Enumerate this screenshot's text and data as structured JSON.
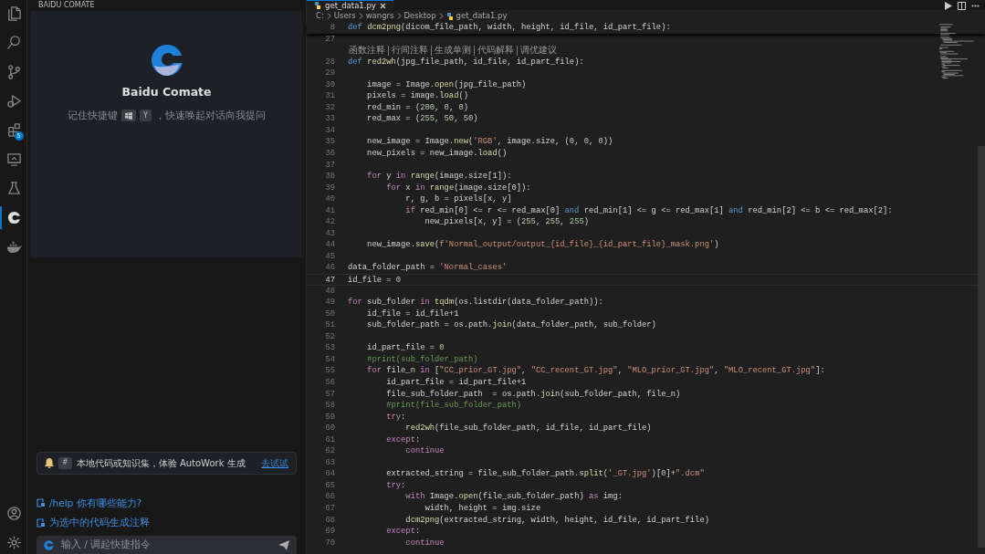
{
  "activity_bar": {
    "items": [
      {
        "kind": "files",
        "selected": false
      },
      {
        "kind": "search",
        "selected": false
      },
      {
        "kind": "source-control",
        "selected": false
      },
      {
        "kind": "run",
        "selected": false
      },
      {
        "kind": "extensions",
        "selected": false,
        "badge": "5"
      },
      {
        "kind": "remote",
        "selected": false
      },
      {
        "kind": "flask",
        "selected": false
      },
      {
        "kind": "comate",
        "selected": true
      },
      {
        "kind": "docker",
        "selected": false
      }
    ],
    "bottom": [
      {
        "kind": "account"
      },
      {
        "kind": "settings"
      }
    ]
  },
  "sidebar": {
    "title": "BAIDU COMATE",
    "welcome": {
      "title": "Baidu Comate",
      "hint_before": "记住快捷键",
      "key": "Y",
      "hint_after": "，快速唤起对话向我提问"
    },
    "notice": {
      "key": "#",
      "text": "本地代码或知识集，体验 AutoWork 生成",
      "link": "去试试"
    },
    "suggestions": [
      "/help 你有哪些能力?",
      "为选中的代码生成注释"
    ],
    "input": {
      "placeholder": "输入 / 调起快捷指令"
    }
  },
  "editor": {
    "tab": {
      "label": "get_data1.py"
    },
    "breadcrumbs": [
      "C:",
      "Users",
      "wangrs",
      "Desktop",
      "get_data1.py"
    ],
    "sticky": {
      "n": "8",
      "s": [
        {
          "kind": "kw",
          "t": "def "
        },
        {
          "kind": "fn",
          "t": "dcm2png"
        },
        {
          "kind": "p",
          "t": "(dicom_file_path, width, height, id_file, id_part_file):"
        }
      ]
    },
    "codelens": [
      "函数注释",
      "行间注释",
      "生成单测",
      "代码解释",
      "调优建议"
    ],
    "lines": [
      {
        "n": "27",
        "current": false
      },
      {
        "n": "28",
        "current": false,
        "lens": true,
        "s": [
          {
            "kind": "kw",
            "t": "def "
          },
          {
            "kind": "fn",
            "t": "red2wh"
          },
          {
            "kind": "p",
            "t": "(jpg_file_path, id_file, id_part_file):"
          }
        ]
      },
      {
        "n": "29",
        "current": false
      },
      {
        "n": "30",
        "current": false,
        "s": [
          {
            "kind": "p",
            "t": "    image = Image."
          },
          {
            "kind": "fn",
            "t": "open"
          },
          {
            "kind": "p",
            "t": "(jpg_file_path)"
          }
        ]
      },
      {
        "n": "31",
        "current": false,
        "s": [
          {
            "kind": "p",
            "t": "    pixels = image."
          },
          {
            "kind": "fn",
            "t": "load"
          },
          {
            "kind": "p",
            "t": "()"
          }
        ]
      },
      {
        "n": "32",
        "current": false,
        "s": [
          {
            "kind": "p",
            "t": "    red_min = ("
          },
          {
            "kind": "num",
            "t": "200"
          },
          {
            "kind": "p",
            "t": ", "
          },
          {
            "kind": "num",
            "t": "0"
          },
          {
            "kind": "p",
            "t": ", "
          },
          {
            "kind": "num",
            "t": "0"
          },
          {
            "kind": "p",
            "t": ")"
          }
        ]
      },
      {
        "n": "33",
        "current": false,
        "s": [
          {
            "kind": "p",
            "t": "    red_max = ("
          },
          {
            "kind": "num",
            "t": "255"
          },
          {
            "kind": "p",
            "t": ", "
          },
          {
            "kind": "num",
            "t": "50"
          },
          {
            "kind": "p",
            "t": ", "
          },
          {
            "kind": "num",
            "t": "50"
          },
          {
            "kind": "p",
            "t": ")"
          }
        ]
      },
      {
        "n": "34",
        "current": false
      },
      {
        "n": "35",
        "current": false,
        "s": [
          {
            "kind": "p",
            "t": "    new_image = Image."
          },
          {
            "kind": "fn",
            "t": "new"
          },
          {
            "kind": "p",
            "t": "("
          },
          {
            "kind": "str",
            "t": "'RGB'"
          },
          {
            "kind": "p",
            "t": ", image.size, ("
          },
          {
            "kind": "num",
            "t": "0"
          },
          {
            "kind": "p",
            "t": ", "
          },
          {
            "kind": "num",
            "t": "0"
          },
          {
            "kind": "p",
            "t": ", "
          },
          {
            "kind": "num",
            "t": "0"
          },
          {
            "kind": "p",
            "t": "))"
          }
        ]
      },
      {
        "n": "36",
        "current": false,
        "s": [
          {
            "kind": "p",
            "t": "    new_pixels = new_image."
          },
          {
            "kind": "fn",
            "t": "load"
          },
          {
            "kind": "p",
            "t": "()"
          }
        ]
      },
      {
        "n": "37",
        "current": false
      },
      {
        "n": "38",
        "current": false,
        "s": [
          {
            "kind": "ctl",
            "t": "    for"
          },
          {
            "kind": "p",
            "t": " y "
          },
          {
            "kind": "ctl",
            "t": "in "
          },
          {
            "kind": "fn",
            "t": "range"
          },
          {
            "kind": "p",
            "t": "(image.size[1]):"
          }
        ]
      },
      {
        "n": "39",
        "current": false,
        "s": [
          {
            "kind": "ctl",
            "t": "        for"
          },
          {
            "kind": "p",
            "t": " x "
          },
          {
            "kind": "ctl",
            "t": "in "
          },
          {
            "kind": "fn",
            "t": "range"
          },
          {
            "kind": "p",
            "t": "(image.size[0]):"
          }
        ]
      },
      {
        "n": "40",
        "current": false,
        "s": [
          {
            "kind": "p",
            "t": "            r, g, b = pixels[x, y]"
          }
        ]
      },
      {
        "n": "41",
        "current": false,
        "s": [
          {
            "kind": "ctl",
            "t": "            if"
          },
          {
            "kind": "p",
            "t": " red_min[0] <= r <= red_max[0] "
          },
          {
            "kind": "kw",
            "t": "and"
          },
          {
            "kind": "p",
            "t": " red_min[1] <= g <= red_max[1] "
          },
          {
            "kind": "kw",
            "t": "and"
          },
          {
            "kind": "p",
            "t": " red_min[2] <= b <= red_max[2]:"
          }
        ]
      },
      {
        "n": "42",
        "current": false,
        "s": [
          {
            "kind": "p",
            "t": "                new_pixels[x, y] = ("
          },
          {
            "kind": "num",
            "t": "255"
          },
          {
            "kind": "p",
            "t": ", "
          },
          {
            "kind": "num",
            "t": "255"
          },
          {
            "kind": "p",
            "t": ", "
          },
          {
            "kind": "num",
            "t": "255"
          },
          {
            "kind": "p",
            "t": ")"
          }
        ]
      },
      {
        "n": "43",
        "current": false
      },
      {
        "n": "44",
        "current": false,
        "s": [
          {
            "kind": "p",
            "t": "    new_image."
          },
          {
            "kind": "fn",
            "t": "save"
          },
          {
            "kind": "p",
            "t": "("
          },
          {
            "kind": "str",
            "t": "f'Normal_output/output_{id_file}_{id_part_file}_mask.png'"
          },
          {
            "kind": "p",
            "t": ")"
          }
        ]
      },
      {
        "n": "45",
        "current": false
      },
      {
        "n": "46",
        "current": false,
        "s": [
          {
            "kind": "p",
            "t": "data_folder_path = "
          },
          {
            "kind": "str",
            "t": "'Normal_cases'"
          }
        ]
      },
      {
        "n": "47",
        "current": true,
        "s": [
          {
            "kind": "p",
            "t": "id_file = "
          },
          {
            "kind": "num",
            "t": "0"
          }
        ]
      },
      {
        "n": "48",
        "current": false
      },
      {
        "n": "49",
        "current": false,
        "s": [
          {
            "kind": "ctl",
            "t": "for"
          },
          {
            "kind": "p",
            "t": " sub_folder "
          },
          {
            "kind": "ctl",
            "t": "in "
          },
          {
            "kind": "fn",
            "t": "tqdm"
          },
          {
            "kind": "p",
            "t": "(os.listdir(data_folder_path)):"
          }
        ]
      },
      {
        "n": "50",
        "current": false,
        "s": [
          {
            "kind": "p",
            "t": "    id_file = id_file+1"
          }
        ]
      },
      {
        "n": "51",
        "current": false,
        "s": [
          {
            "kind": "p",
            "t": "    sub_folder_path = os.path."
          },
          {
            "kind": "fn",
            "t": "join"
          },
          {
            "kind": "p",
            "t": "(data_folder_path, sub_folder)"
          }
        ]
      },
      {
        "n": "52",
        "current": false
      },
      {
        "n": "53",
        "current": false,
        "s": [
          {
            "kind": "p",
            "t": "    id_part_file = "
          },
          {
            "kind": "num",
            "t": "0"
          }
        ]
      },
      {
        "n": "54",
        "current": false,
        "s": [
          {
            "kind": "cm",
            "t": "    #print(sub_folder_path)"
          }
        ]
      },
      {
        "n": "55",
        "current": false,
        "s": [
          {
            "kind": "ctl",
            "t": "    for"
          },
          {
            "kind": "p",
            "t": " file_n "
          },
          {
            "kind": "ctl",
            "t": "in"
          },
          {
            "kind": "p",
            "t": " ["
          },
          {
            "kind": "str",
            "t": "\"CC_prior_GT.jpg\""
          },
          {
            "kind": "p",
            "t": ", "
          },
          {
            "kind": "str",
            "t": "\"CC_recent_GT.jpg\""
          },
          {
            "kind": "p",
            "t": ", "
          },
          {
            "kind": "str",
            "t": "\"MLO_prior_GT.jpg\""
          },
          {
            "kind": "p",
            "t": ", "
          },
          {
            "kind": "str",
            "t": "\"MLO_recent_GT.jpg\""
          },
          {
            "kind": "p",
            "t": "]:"
          }
        ]
      },
      {
        "n": "56",
        "current": false,
        "s": [
          {
            "kind": "p",
            "t": "        id_part_file = id_part_file+1"
          }
        ]
      },
      {
        "n": "57",
        "current": false,
        "s": [
          {
            "kind": "p",
            "t": "        file_sub_folder_path  = os.path."
          },
          {
            "kind": "fn",
            "t": "join"
          },
          {
            "kind": "p",
            "t": "(sub_folder_path, file_n)"
          }
        ]
      },
      {
        "n": "58",
        "current": false,
        "s": [
          {
            "kind": "cm",
            "t": "        #print(file_sub_folder_path)"
          }
        ]
      },
      {
        "n": "59",
        "current": false,
        "s": [
          {
            "kind": "ctl",
            "t": "        try"
          },
          {
            "kind": "p",
            "t": ":"
          }
        ]
      },
      {
        "n": "60",
        "current": false,
        "s": [
          {
            "kind": "fn",
            "t": "            red2wh"
          },
          {
            "kind": "p",
            "t": "(file_sub_folder_path, id_file, id_part_file)"
          }
        ]
      },
      {
        "n": "61",
        "current": false,
        "s": [
          {
            "kind": "ctl",
            "t": "        except"
          },
          {
            "kind": "p",
            "t": ":"
          }
        ]
      },
      {
        "n": "62",
        "current": false,
        "s": [
          {
            "kind": "ctl",
            "t": "            continue"
          }
        ]
      },
      {
        "n": "63",
        "current": false
      },
      {
        "n": "64",
        "current": false,
        "s": [
          {
            "kind": "p",
            "t": "        extracted_string = file_sub_folder_path."
          },
          {
            "kind": "fn",
            "t": "split"
          },
          {
            "kind": "p",
            "t": "("
          },
          {
            "kind": "str",
            "t": "'_GT.jpg'"
          },
          {
            "kind": "p",
            "t": ")["
          },
          {
            "kind": "num",
            "t": "0"
          },
          {
            "kind": "p",
            "t": "]+"
          },
          {
            "kind": "str",
            "t": "\".dcm\""
          }
        ]
      },
      {
        "n": "65",
        "current": false,
        "s": [
          {
            "kind": "ctl",
            "t": "        try"
          },
          {
            "kind": "p",
            "t": ":"
          }
        ]
      },
      {
        "n": "66",
        "current": false,
        "s": [
          {
            "kind": "ctl",
            "t": "            with"
          },
          {
            "kind": "p",
            "t": " Image."
          },
          {
            "kind": "fn",
            "t": "open"
          },
          {
            "kind": "p",
            "t": "(file_sub_folder_path) "
          },
          {
            "kind": "ctl",
            "t": "as"
          },
          {
            "kind": "p",
            "t": " img:"
          }
        ]
      },
      {
        "n": "67",
        "current": false,
        "s": [
          {
            "kind": "p",
            "t": "                width, height = img.size"
          }
        ]
      },
      {
        "n": "68",
        "current": false,
        "s": [
          {
            "kind": "fn",
            "t": "            dcm2png"
          },
          {
            "kind": "p",
            "t": "(extracted_string, width, height, id_file, id_part_file)"
          }
        ]
      },
      {
        "n": "69",
        "current": false,
        "s": [
          {
            "kind": "ctl",
            "t": "        except"
          },
          {
            "kind": "p",
            "t": ":"
          }
        ]
      },
      {
        "n": "70",
        "current": false,
        "s": [
          {
            "kind": "ctl",
            "t": "            continue"
          }
        ]
      }
    ]
  }
}
